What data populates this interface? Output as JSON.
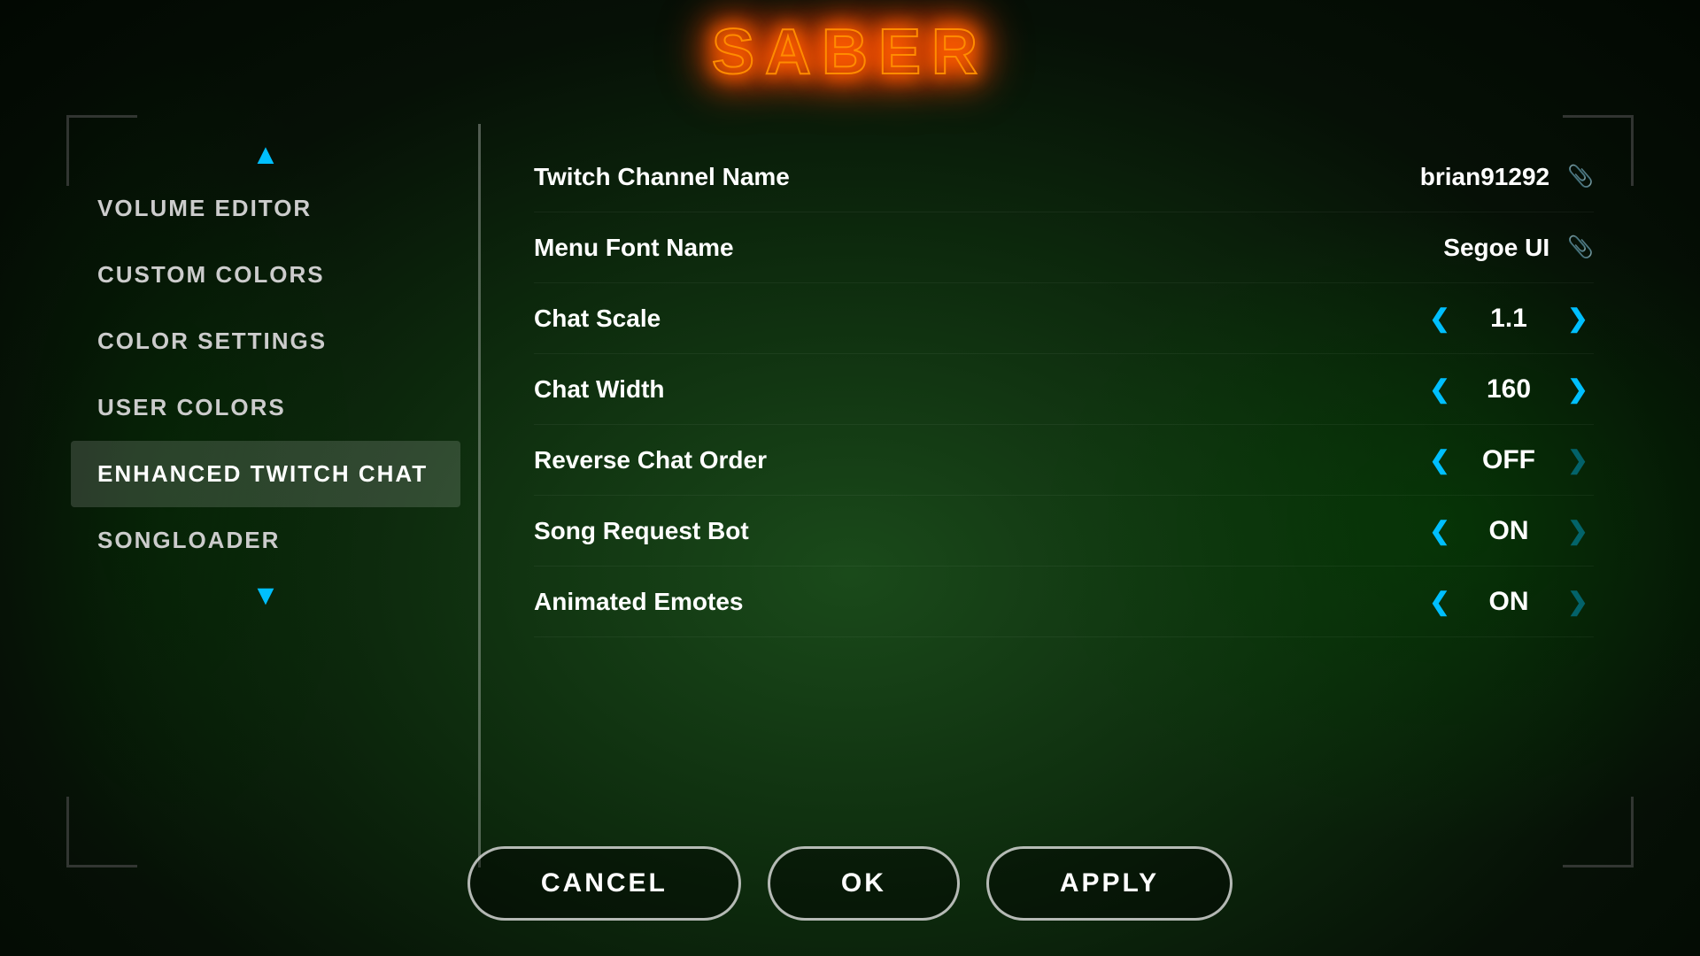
{
  "title": "SABER",
  "sidebar": {
    "items": [
      {
        "id": "volume-editor",
        "label": "VOLUME EDITOR",
        "active": false
      },
      {
        "id": "custom-colors",
        "label": "CUSTOM COLORS",
        "active": false
      },
      {
        "id": "color-settings",
        "label": "COLOR SETTINGS",
        "active": false
      },
      {
        "id": "user-colors",
        "label": "USER COLORS",
        "active": false
      },
      {
        "id": "enhanced-twitch-chat",
        "label": "ENHANCED TWITCH CHAT",
        "active": true
      },
      {
        "id": "songloader",
        "label": "SONGLOADER",
        "active": false
      }
    ],
    "arrow_up": "▲",
    "arrow_down": "▼"
  },
  "settings": [
    {
      "id": "twitch-channel-name",
      "label": "Twitch Channel Name",
      "type": "text",
      "value": "brian91292",
      "has_edit": true
    },
    {
      "id": "menu-font-name",
      "label": "Menu Font Name",
      "type": "text",
      "value": "Segoe UI",
      "has_edit": true
    },
    {
      "id": "chat-scale",
      "label": "Chat Scale",
      "type": "stepper",
      "value": "1.1",
      "has_left": true,
      "has_right": true
    },
    {
      "id": "chat-width",
      "label": "Chat Width",
      "type": "stepper",
      "value": "160",
      "has_left": true,
      "has_right": true
    },
    {
      "id": "reverse-chat-order",
      "label": "Reverse Chat Order",
      "type": "stepper",
      "value": "OFF",
      "has_left": true,
      "has_right": true,
      "dim_right": true
    },
    {
      "id": "song-request-bot",
      "label": "Song Request Bot",
      "type": "stepper",
      "value": "ON",
      "has_left": true,
      "has_right": true,
      "dim_right": true
    },
    {
      "id": "animated-emotes",
      "label": "Animated Emotes",
      "type": "stepper",
      "value": "ON",
      "has_left": true,
      "has_right": true,
      "dim_right": true
    }
  ],
  "buttons": {
    "cancel": "CANCEL",
    "ok": "OK",
    "apply": "APPLY"
  }
}
